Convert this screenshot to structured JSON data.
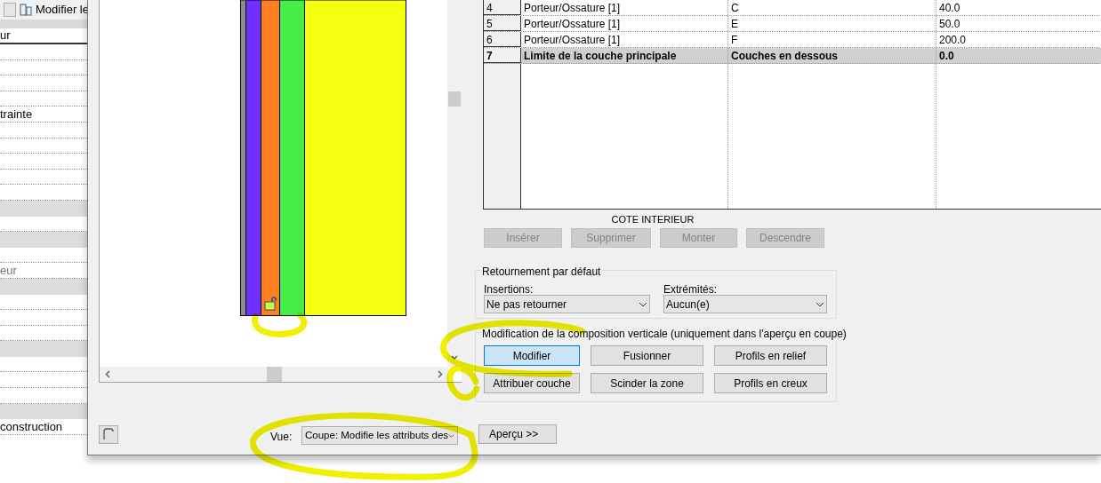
{
  "properties_panel": {
    "edit_type_label": "Modifier le",
    "rows": [
      {
        "kind": "header",
        "text": "ur"
      },
      {
        "kind": "row",
        "text": ""
      },
      {
        "kind": "row",
        "text": ""
      },
      {
        "kind": "row",
        "text": ""
      },
      {
        "kind": "row",
        "text": ""
      },
      {
        "kind": "row",
        "text": "trainte"
      },
      {
        "kind": "row",
        "text": ""
      },
      {
        "kind": "row",
        "text": ""
      },
      {
        "kind": "row",
        "text": ""
      },
      {
        "kind": "row",
        "text": ""
      },
      {
        "kind": "row",
        "text": ""
      },
      {
        "kind": "section",
        "text": ""
      },
      {
        "kind": "row",
        "text": ""
      },
      {
        "kind": "section",
        "text": ""
      },
      {
        "kind": "row",
        "text": ""
      },
      {
        "kind": "row",
        "text": "eur",
        "greyed": true
      },
      {
        "kind": "section",
        "text": ""
      },
      {
        "kind": "row",
        "text": ""
      },
      {
        "kind": "row",
        "text": ""
      },
      {
        "kind": "row",
        "text": ""
      },
      {
        "kind": "section",
        "text": ""
      },
      {
        "kind": "row",
        "text": ""
      },
      {
        "kind": "row",
        "text": ""
      },
      {
        "kind": "row",
        "text": ""
      },
      {
        "kind": "section",
        "text": ""
      },
      {
        "kind": "row",
        "text": "construction"
      }
    ]
  },
  "layers_table": {
    "rows": [
      {
        "number": "4",
        "function": "Porteur/Ossature [1]",
        "material": "C",
        "thickness": "40.0",
        "core_boundary": false
      },
      {
        "number": "5",
        "function": "Porteur/Ossature [1]",
        "material": "E",
        "thickness": "50.0",
        "core_boundary": false
      },
      {
        "number": "6",
        "function": "Porteur/Ossature [1]",
        "material": "F",
        "thickness": "200.0",
        "core_boundary": false
      },
      {
        "number": "7",
        "function": "Limite de la couche principale",
        "material": "Couches en dessous",
        "thickness": "0.0",
        "core_boundary": true
      }
    ],
    "footer_label": "COTE INTERIEUR",
    "buttons": [
      {
        "label": "Insérer",
        "disabled": true
      },
      {
        "label": "Supprimer",
        "disabled": true
      },
      {
        "label": "Monter",
        "disabled": true
      },
      {
        "label": "Descendre",
        "disabled": true
      }
    ]
  },
  "default_wrapping": {
    "title": "Retournement par défaut",
    "inserts_label": "Insertions:",
    "inserts_value": "Ne pas retourner",
    "ends_label": "Extrémités:",
    "ends_value": "Aucun(e)"
  },
  "vertical_structure": {
    "title": "Modification de la composition verticale (uniquement dans l'aperçu en coupe)",
    "buttons": [
      {
        "label": "Modifier",
        "selected": true
      },
      {
        "label": "Fusionner",
        "selected": false
      },
      {
        "label": "Profils en relief",
        "selected": false
      },
      {
        "label": "Attribuer couche",
        "selected": false
      },
      {
        "label": "Scinder la zone",
        "selected": false
      },
      {
        "label": "Profils en creux",
        "selected": false
      }
    ]
  },
  "preview": {
    "layers": [
      {
        "color": "#8c8c8c"
      },
      {
        "color": "#7030ff"
      },
      {
        "color": "#ff8020"
      },
      {
        "color": "#48ee48"
      },
      {
        "color": "#f5ff10"
      }
    ]
  },
  "footer": {
    "view_label": "Vue:",
    "view_value": "Coupe: Modifie les attributs des",
    "preview_button": "Aperçu >>"
  }
}
